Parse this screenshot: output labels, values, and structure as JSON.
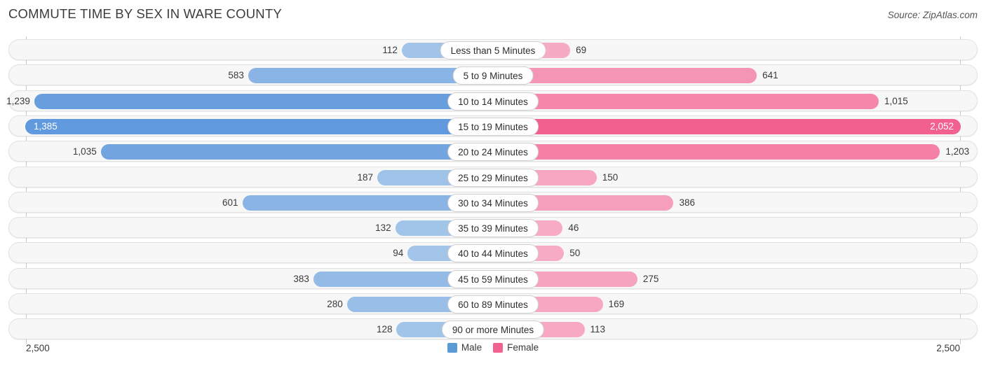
{
  "title": "COMMUTE TIME BY SEX IN WARE COUNTY",
  "source": "Source: ZipAtlas.com",
  "axis": {
    "left": "2,500",
    "right": "2,500"
  },
  "legend": [
    {
      "label": "Male",
      "color": "#5b9bd5"
    },
    {
      "label": "Female",
      "color": "#f2628f"
    }
  ],
  "colors": {
    "male_light": "#a8c8ea",
    "male_dark": "#6099dd",
    "female_light": "#f7adc6",
    "female_dark": "#f2608f",
    "track": "#f7f7f7",
    "gridline": "#c9c9c9"
  },
  "chart_data": {
    "type": "bar",
    "subtype": "diverging-horizontal",
    "title": "COMMUTE TIME BY SEX IN WARE COUNTY",
    "xlabel": "",
    "ylabel": "",
    "xlim": [
      0,
      2500
    ],
    "grid": false,
    "legend_position": "bottom-center",
    "categories": [
      "Less than 5 Minutes",
      "5 to 9 Minutes",
      "10 to 14 Minutes",
      "15 to 19 Minutes",
      "20 to 24 Minutes",
      "25 to 29 Minutes",
      "30 to 34 Minutes",
      "35 to 39 Minutes",
      "40 to 44 Minutes",
      "45 to 59 Minutes",
      "60 to 89 Minutes",
      "90 or more Minutes"
    ],
    "series": [
      {
        "name": "Male",
        "direction": "left",
        "values": [
          112,
          583,
          1239,
          1385,
          1035,
          187,
          601,
          132,
          94,
          383,
          280,
          128
        ],
        "labels": [
          "112",
          "583",
          "1,239",
          "1,385",
          "1,035",
          "187",
          "601",
          "132",
          "94",
          "383",
          "280",
          "128"
        ]
      },
      {
        "name": "Female",
        "direction": "right",
        "values": [
          69,
          641,
          1015,
          2052,
          1203,
          150,
          386,
          46,
          50,
          275,
          169,
          113
        ],
        "labels": [
          "69",
          "641",
          "1,015",
          "2,052",
          "1,203",
          "150",
          "386",
          "46",
          "50",
          "275",
          "169",
          "113"
        ]
      }
    ]
  }
}
